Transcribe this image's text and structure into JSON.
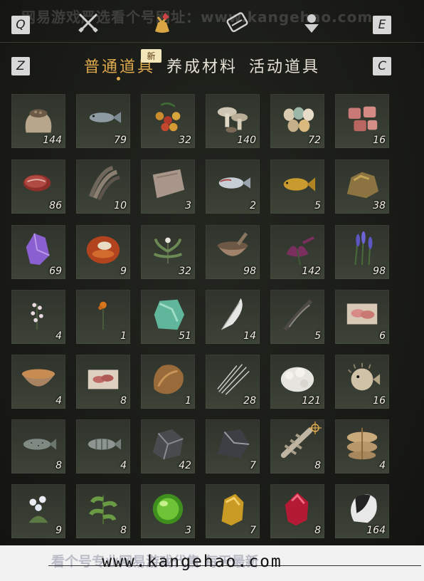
{
  "watermark_top": "网易游戏严选看个号网址：www.kangehao.com",
  "keys": {
    "q": "Q",
    "e": "E",
    "z": "Z",
    "c": "C"
  },
  "tabs": [
    {
      "label": "普通道具",
      "active": true,
      "badge": "新"
    },
    {
      "label": "养成材料",
      "active": false
    },
    {
      "label": "活动道具",
      "active": false
    }
  ],
  "items": [
    {
      "icon": "grain-sack-icon",
      "count": "144"
    },
    {
      "icon": "fish-icon",
      "count": "79"
    },
    {
      "icon": "berries-icon",
      "count": "32"
    },
    {
      "icon": "mushrooms-icon",
      "count": "140"
    },
    {
      "icon": "eggs-icon",
      "count": "72"
    },
    {
      "icon": "raw-meat-chunks-icon",
      "count": "16"
    },
    {
      "icon": "steak-icon",
      "count": "86"
    },
    {
      "icon": "feathers-icon",
      "count": "10"
    },
    {
      "icon": "hide-icon",
      "count": "3"
    },
    {
      "icon": "silver-fish-icon",
      "count": "2"
    },
    {
      "icon": "golden-carp-icon",
      "count": "5"
    },
    {
      "icon": "ore-lump-icon",
      "count": "38"
    },
    {
      "icon": "amethyst-icon",
      "count": "69"
    },
    {
      "icon": "agate-icon",
      "count": "9"
    },
    {
      "icon": "herb-icon",
      "count": "32"
    },
    {
      "icon": "mortar-icon",
      "count": "98"
    },
    {
      "icon": "purple-flower-icon",
      "count": "142"
    },
    {
      "icon": "lavender-icon",
      "count": "98"
    },
    {
      "icon": "white-blossom-icon",
      "count": "4"
    },
    {
      "icon": "orange-flower-icon",
      "count": "1"
    },
    {
      "icon": "jade-stone-icon",
      "count": "51"
    },
    {
      "icon": "white-feather-icon",
      "count": "14"
    },
    {
      "icon": "dark-feather-icon",
      "count": "5"
    },
    {
      "icon": "meat-on-paper-icon",
      "count": "6"
    },
    {
      "icon": "soup-bowl-icon",
      "count": "4"
    },
    {
      "icon": "sliced-meat-icon",
      "count": "8"
    },
    {
      "icon": "fur-pelt-icon",
      "count": "1"
    },
    {
      "icon": "quills-icon",
      "count": "28"
    },
    {
      "icon": "white-fleece-icon",
      "count": "121"
    },
    {
      "icon": "pufferfish-icon",
      "count": "16"
    },
    {
      "icon": "trout-icon",
      "count": "8"
    },
    {
      "icon": "perch-icon",
      "count": "4"
    },
    {
      "icon": "iron-ore-icon",
      "count": "42"
    },
    {
      "icon": "dark-ore-icon",
      "count": "7"
    },
    {
      "icon": "bone-icon",
      "count": "8"
    },
    {
      "icon": "sandbag-bundle-icon",
      "count": "4"
    },
    {
      "icon": "white-flower-bush-icon",
      "count": "9"
    },
    {
      "icon": "green-sprout-icon",
      "count": "8"
    },
    {
      "icon": "green-orb-icon",
      "count": "3"
    },
    {
      "icon": "gold-nugget-icon",
      "count": "7"
    },
    {
      "icon": "ruby-icon",
      "count": "8"
    },
    {
      "icon": "black-white-fur-icon",
      "count": "164"
    }
  ],
  "footer": {
    "watermark": "看个号专业网易游戏代售 每天最新",
    "url": "www.kangehao.com"
  }
}
